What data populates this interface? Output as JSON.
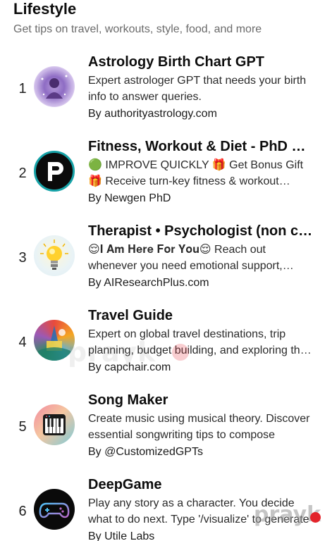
{
  "section": {
    "title": "Lifestyle",
    "subtitle": "Get tips on travel, workouts, style, food, and more"
  },
  "items": [
    {
      "rank": "1",
      "title": "Astrology Birth Chart GPT",
      "description": "Expert astrologer GPT that needs your birth info to answer queries.",
      "author": "By authorityastrology.com",
      "icon": "astrology-portrait-icon"
    },
    {
      "rank": "2",
      "title": "Fitness, Workout & Diet - PhD Coach",
      "description": "🟢 IMPROVE QUICKLY 🎁 Get Bonus Gift 🎁 Receive turn-key fitness & workout support",
      "author": "By Newgen PhD",
      "icon": "p-logo-icon"
    },
    {
      "rank": "3",
      "title": "Therapist • Psychologist (non clinical)",
      "description": "😌𝐈 𝐀𝐦 𝐇𝐞𝐫𝐞 𝐅𝐨𝐫 𝐘𝐨𝐮😌 Reach out whenever you need emotional support, guidance",
      "author": "By AIResearchPlus.com",
      "icon": "lightbulb-icon"
    },
    {
      "rank": "4",
      "title": "Travel Guide",
      "description": "Expert on global travel destinations, trip planning, budget building, and exploring the world",
      "author": "By capchair.com",
      "icon": "travel-collage-icon"
    },
    {
      "rank": "5",
      "title": "Song Maker",
      "description": "Create music using musical theory. Discover essential songwriting tips to compose",
      "author": "By @CustomizedGPTs",
      "icon": "piano-keys-icon"
    },
    {
      "rank": "6",
      "title": "DeepGame",
      "description": "Play any story as a character. You decide what to do next. Type '/visualize' to generate",
      "author": "By Utile Labs",
      "icon": "gamepad-icon"
    }
  ],
  "watermark": {
    "text": "prayk"
  },
  "colors": {
    "background": "#ffffff",
    "text": "#0d0d0d",
    "subtext": "#6b6b6b",
    "watermark_dot": "#e3242b"
  }
}
